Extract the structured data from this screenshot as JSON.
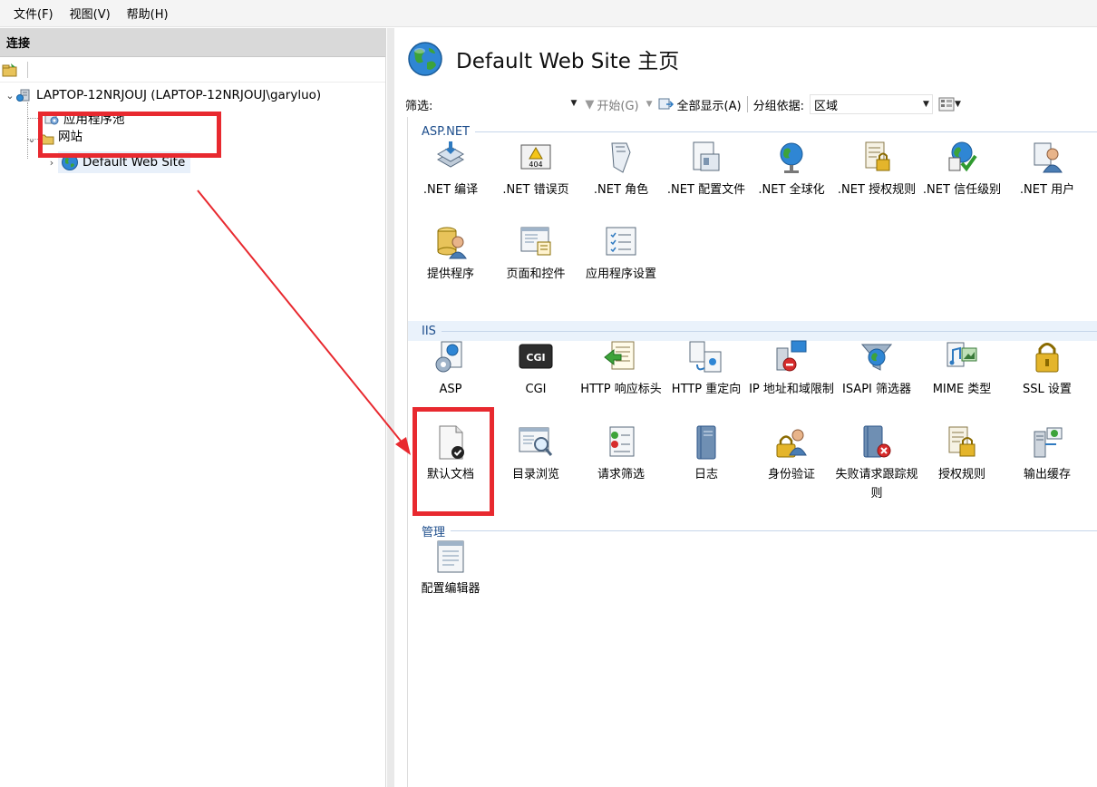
{
  "menu": {
    "file": "文件(F)",
    "view": "视图(V)",
    "help": "帮助(H)"
  },
  "connections": {
    "header": "连接",
    "tree": {
      "server": "LAPTOP-12NRJOUJ (LAPTOP-12NRJOUJ\\garyluo)",
      "app_pools": "应用程序池",
      "sites": "网站",
      "default_site": "Default Web Site"
    }
  },
  "main": {
    "title": "Default Web Site 主页",
    "filter": {
      "label": "筛选:",
      "start": "开始(G)",
      "show_all": "全部显示(A)",
      "group_by_label": "分组依据:",
      "group_by_value": "区域"
    },
    "groups": [
      {
        "name": "ASP.NET",
        "items": [
          {
            "label": ".NET 编译",
            "icon": "net-compilation-icon"
          },
          {
            "label": ".NET 错误页",
            "icon": "net-error-pages-icon"
          },
          {
            "label": ".NET 角色",
            "icon": "net-roles-icon"
          },
          {
            "label": ".NET 配置文件",
            "icon": "net-profile-icon"
          },
          {
            "label": ".NET 全球化",
            "icon": "net-globalization-icon"
          },
          {
            "label": ".NET 授权规则",
            "icon": "net-authorization-icon"
          },
          {
            "label": ".NET 信任级别",
            "icon": "net-trust-levels-icon"
          },
          {
            "label": ".NET 用户",
            "icon": "net-users-icon"
          },
          {
            "label": "提供程序",
            "icon": "providers-icon"
          },
          {
            "label": "页面和控件",
            "icon": "pages-controls-icon"
          },
          {
            "label": "应用程序设置",
            "icon": "app-settings-icon"
          }
        ]
      },
      {
        "name": "IIS",
        "items": [
          {
            "label": "ASP",
            "icon": "asp-icon"
          },
          {
            "label": "CGI",
            "icon": "cgi-icon"
          },
          {
            "label": "HTTP 响应标头",
            "icon": "http-response-headers-icon"
          },
          {
            "label": "HTTP 重定向",
            "icon": "http-redirect-icon"
          },
          {
            "label": "IP 地址和域限制",
            "icon": "ip-domain-restrictions-icon"
          },
          {
            "label": "ISAPI 筛选器",
            "icon": "isapi-filters-icon"
          },
          {
            "label": "MIME 类型",
            "icon": "mime-types-icon"
          },
          {
            "label": "SSL 设置",
            "icon": "ssl-settings-icon"
          },
          {
            "label": "默认文档",
            "icon": "default-document-icon"
          },
          {
            "label": "目录浏览",
            "icon": "directory-browsing-icon"
          },
          {
            "label": "请求筛选",
            "icon": "request-filtering-icon"
          },
          {
            "label": "日志",
            "icon": "logging-icon"
          },
          {
            "label": "身份验证",
            "icon": "authentication-icon"
          },
          {
            "label": "失败请求跟踪规则",
            "icon": "failed-request-tracing-icon"
          },
          {
            "label": "授权规则",
            "icon": "authorization-rules-icon"
          },
          {
            "label": "输出缓存",
            "icon": "output-caching-icon"
          }
        ]
      },
      {
        "name": "管理",
        "items": [
          {
            "label": "配置编辑器",
            "icon": "configuration-editor-icon"
          }
        ]
      }
    ]
  },
  "colors": {
    "highlight": "#e8292f",
    "group_header": "#1e4e8c"
  }
}
